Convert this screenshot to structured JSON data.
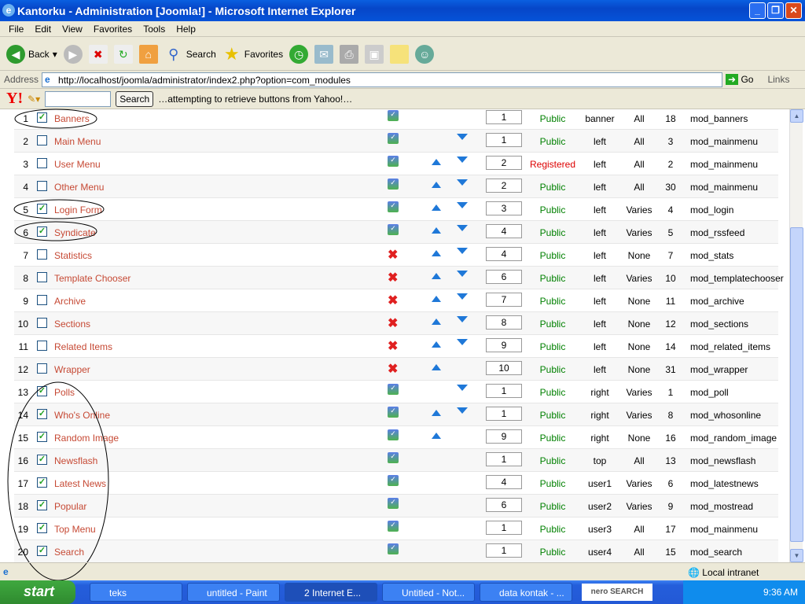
{
  "window": {
    "title": "Kantorku - Administration [Joomla!] - Microsoft Internet Explorer"
  },
  "menu": [
    "File",
    "Edit",
    "View",
    "Favorites",
    "Tools",
    "Help"
  ],
  "toolbar": {
    "back": "Back",
    "search": "Search",
    "favorites": "Favorites"
  },
  "address": {
    "label": "Address",
    "url": "http://localhost/joomla/administrator/index2.php?option=com_modules",
    "go": "Go",
    "links": "Links"
  },
  "yahoo": {
    "logo": "Y!",
    "search_value": "",
    "search_button": "Search",
    "status": "…attempting to retrieve buttons from Yahoo!…"
  },
  "colors": {
    "published": "#008000",
    "registered": "#dd0000",
    "link": "#c64934",
    "arrow": "#1f78d8"
  },
  "rows": [
    {
      "n": "1",
      "name": "Banners",
      "checked": true,
      "published": true,
      "up": false,
      "down": false,
      "order": "1",
      "access": "Public",
      "position": "banner",
      "pages": "All",
      "id": "18",
      "type": "mod_banners"
    },
    {
      "n": "2",
      "name": "Main Menu",
      "checked": false,
      "published": true,
      "up": false,
      "down": true,
      "order": "1",
      "access": "Public",
      "position": "left",
      "pages": "All",
      "id": "3",
      "type": "mod_mainmenu"
    },
    {
      "n": "3",
      "name": "User Menu",
      "checked": false,
      "published": true,
      "up": true,
      "down": true,
      "order": "2",
      "access": "Registered",
      "position": "left",
      "pages": "All",
      "id": "2",
      "type": "mod_mainmenu"
    },
    {
      "n": "4",
      "name": "Other Menu",
      "checked": false,
      "published": true,
      "up": true,
      "down": true,
      "order": "2",
      "access": "Public",
      "position": "left",
      "pages": "All",
      "id": "30",
      "type": "mod_mainmenu"
    },
    {
      "n": "5",
      "name": "Login Form",
      "checked": true,
      "published": true,
      "up": true,
      "down": true,
      "order": "3",
      "access": "Public",
      "position": "left",
      "pages": "Varies",
      "id": "4",
      "type": "mod_login"
    },
    {
      "n": "6",
      "name": "Syndicate",
      "checked": true,
      "published": true,
      "up": true,
      "down": true,
      "order": "4",
      "access": "Public",
      "position": "left",
      "pages": "Varies",
      "id": "5",
      "type": "mod_rssfeed"
    },
    {
      "n": "7",
      "name": "Statistics",
      "checked": false,
      "published": false,
      "up": true,
      "down": true,
      "order": "4",
      "access": "Public",
      "position": "left",
      "pages": "None",
      "id": "7",
      "type": "mod_stats"
    },
    {
      "n": "8",
      "name": "Template Chooser",
      "checked": false,
      "published": false,
      "up": true,
      "down": true,
      "order": "6",
      "access": "Public",
      "position": "left",
      "pages": "Varies",
      "id": "10",
      "type": "mod_templatechooser"
    },
    {
      "n": "9",
      "name": "Archive",
      "checked": false,
      "published": false,
      "up": true,
      "down": true,
      "order": "7",
      "access": "Public",
      "position": "left",
      "pages": "None",
      "id": "11",
      "type": "mod_archive"
    },
    {
      "n": "10",
      "name": "Sections",
      "checked": false,
      "published": false,
      "up": true,
      "down": true,
      "order": "8",
      "access": "Public",
      "position": "left",
      "pages": "None",
      "id": "12",
      "type": "mod_sections"
    },
    {
      "n": "11",
      "name": "Related Items",
      "checked": false,
      "published": false,
      "up": true,
      "down": true,
      "order": "9",
      "access": "Public",
      "position": "left",
      "pages": "None",
      "id": "14",
      "type": "mod_related_items"
    },
    {
      "n": "12",
      "name": "Wrapper",
      "checked": false,
      "published": false,
      "up": true,
      "down": false,
      "order": "10",
      "access": "Public",
      "position": "left",
      "pages": "None",
      "id": "31",
      "type": "mod_wrapper"
    },
    {
      "n": "13",
      "name": "Polls",
      "checked": true,
      "published": true,
      "up": false,
      "down": true,
      "order": "1",
      "access": "Public",
      "position": "right",
      "pages": "Varies",
      "id": "1",
      "type": "mod_poll"
    },
    {
      "n": "14",
      "name": "Who's Online",
      "checked": true,
      "published": true,
      "up": true,
      "down": true,
      "order": "1",
      "access": "Public",
      "position": "right",
      "pages": "Varies",
      "id": "8",
      "type": "mod_whosonline"
    },
    {
      "n": "15",
      "name": "Random Image",
      "checked": true,
      "published": true,
      "up": true,
      "down": false,
      "order": "9",
      "access": "Public",
      "position": "right",
      "pages": "None",
      "id": "16",
      "type": "mod_random_image"
    },
    {
      "n": "16",
      "name": "Newsflash",
      "checked": true,
      "published": true,
      "up": false,
      "down": false,
      "order": "1",
      "access": "Public",
      "position": "top",
      "pages": "All",
      "id": "13",
      "type": "mod_newsflash"
    },
    {
      "n": "17",
      "name": "Latest News",
      "checked": true,
      "published": true,
      "up": false,
      "down": false,
      "order": "4",
      "access": "Public",
      "position": "user1",
      "pages": "Varies",
      "id": "6",
      "type": "mod_latestnews"
    },
    {
      "n": "18",
      "name": "Popular",
      "checked": true,
      "published": true,
      "up": false,
      "down": false,
      "order": "6",
      "access": "Public",
      "position": "user2",
      "pages": "Varies",
      "id": "9",
      "type": "mod_mostread"
    },
    {
      "n": "19",
      "name": "Top Menu",
      "checked": true,
      "published": true,
      "up": false,
      "down": false,
      "order": "1",
      "access": "Public",
      "position": "user3",
      "pages": "All",
      "id": "17",
      "type": "mod_mainmenu"
    },
    {
      "n": "20",
      "name": "Search",
      "checked": true,
      "published": true,
      "up": false,
      "down": false,
      "order": "1",
      "access": "Public",
      "position": "user4",
      "pages": "All",
      "id": "15",
      "type": "mod_search"
    }
  ],
  "statusbar": {
    "zone": "Local intranet"
  },
  "taskbar": {
    "start": "start",
    "tasks": [
      "teks",
      "untitled - Paint",
      "2 Internet E...",
      "Untitled - Not...",
      "data kontak - ..."
    ],
    "nero": "nero SEARCH",
    "clock": "9:36 AM"
  }
}
